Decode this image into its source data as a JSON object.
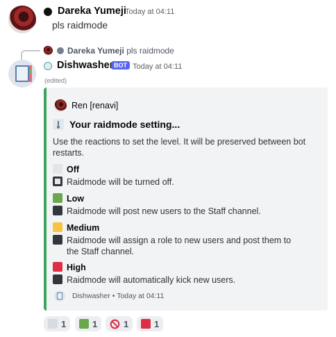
{
  "message1": {
    "username": "Dareka Yumeji",
    "timestamp": "Today at 04:11",
    "content": "pls raidmode"
  },
  "reply_preview": {
    "username": "Dareka Yumeji",
    "content": "pls raidmode"
  },
  "message2": {
    "username": "Dishwasher",
    "bot_tag": "BOT",
    "timestamp": "Today at 04:11",
    "edited": "(edited)"
  },
  "embed": {
    "author": "Ren [renavi]",
    "title": "Your raidmode setting...",
    "description": "Use the reactions to set the level. It will be preserved between bot restarts.",
    "options": [
      {
        "name": "Off",
        "desc": "Raidmode will be turned off.",
        "color": "#e3e5e8"
      },
      {
        "name": "Low",
        "desc": "Raidmode will post new users to the Staff channel.",
        "color": "#6aa84f"
      },
      {
        "name": "Medium",
        "desc": "Raidmode will assign a role to new users and post them to the Staff channel.",
        "color": "#f6c344"
      },
      {
        "name": "High",
        "desc": "Raidmode will automatically kick new users.",
        "color": "#dd2e44"
      }
    ],
    "footer_name": "Dishwasher",
    "footer_separator": "•",
    "footer_time": "Today at 04:11",
    "accent": "#3ba55c"
  },
  "reactions": [
    {
      "icon": "white-square-icon",
      "count": "1"
    },
    {
      "icon": "green-square-icon",
      "count": "1"
    },
    {
      "icon": "no-entry-icon",
      "count": "1"
    },
    {
      "icon": "red-square-icon",
      "count": "1"
    }
  ]
}
